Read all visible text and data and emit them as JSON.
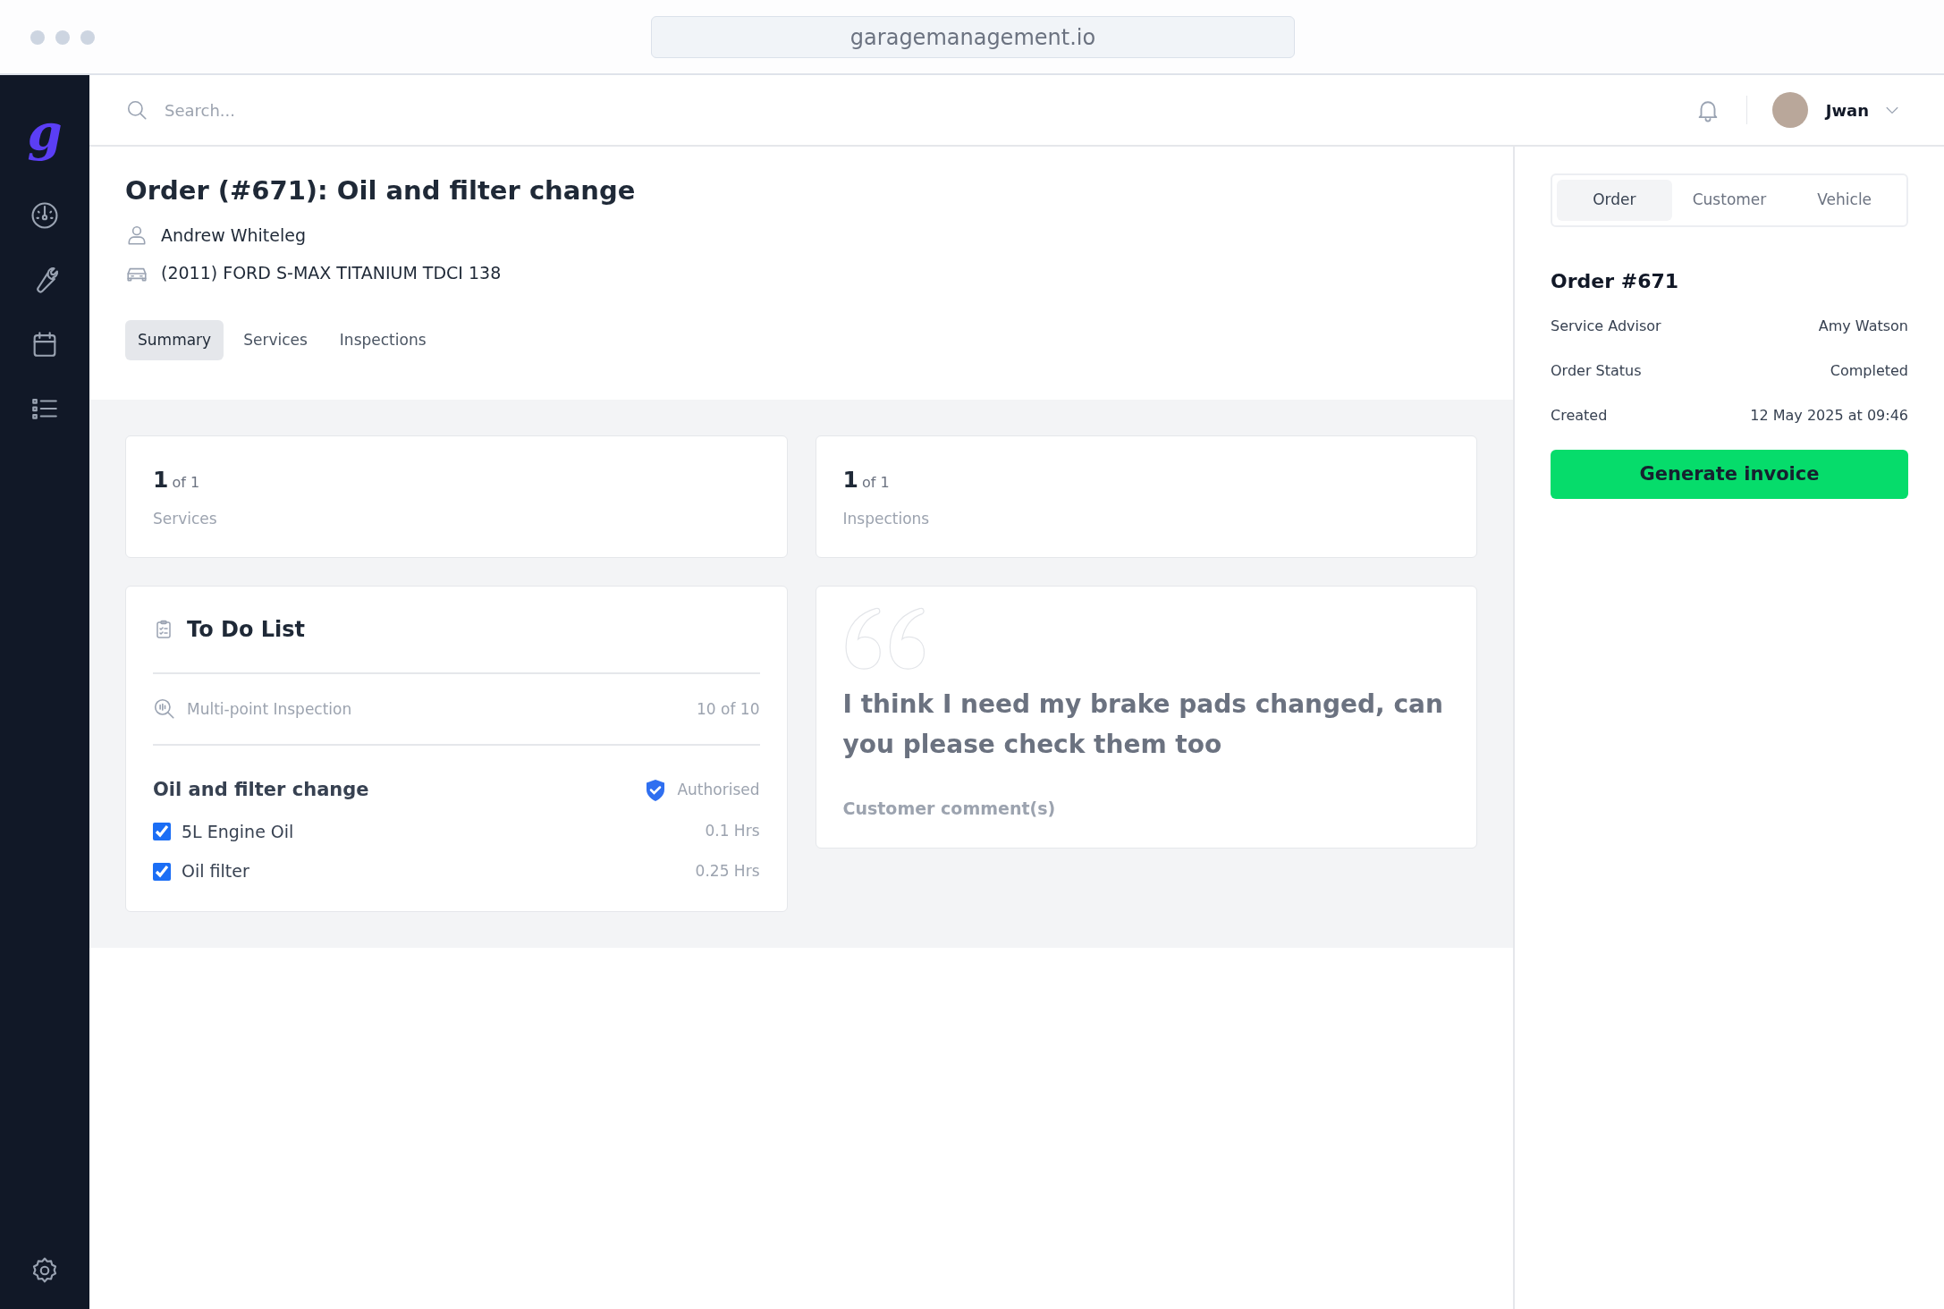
{
  "browser": {
    "url": "garagemanagement.io"
  },
  "sidebar": {
    "logo": "g"
  },
  "header": {
    "search_placeholder": "Search...",
    "user_name": "Jwan"
  },
  "order": {
    "title": "Order (#671): Oil and filter change",
    "customer": "Andrew Whiteleg",
    "vehicle": "(2011) FORD S-MAX TITANIUM TDCI 138",
    "tabs": [
      {
        "label": "Summary",
        "selected": true
      },
      {
        "label": "Services",
        "selected": false
      },
      {
        "label": "Inspections",
        "selected": false
      }
    ]
  },
  "stats": [
    {
      "count": "1",
      "total": "of 1",
      "label": "Services"
    },
    {
      "count": "1",
      "total": "of 1",
      "label": "Inspections"
    }
  ],
  "todo": {
    "title": "To Do List",
    "inspection": {
      "label": "Multi-point Inspection",
      "progress": "10 of 10"
    },
    "service": {
      "title": "Oil and filter change",
      "status": "Authorised"
    },
    "items": [
      {
        "label": "5L Engine Oil",
        "checked": true,
        "hours": "0.1 Hrs"
      },
      {
        "label": "Oil filter",
        "checked": true,
        "hours": "0.25 Hrs"
      }
    ]
  },
  "comment": {
    "text": "I think I need my brake pads changed, can you please check them too",
    "label": "Customer comment(s)"
  },
  "panel": {
    "tabs": [
      {
        "label": "Order",
        "selected": true
      },
      {
        "label": "Customer",
        "selected": false
      },
      {
        "label": "Vehicle",
        "selected": false
      }
    ],
    "heading": "Order #671",
    "fields": [
      {
        "label": "Service Advisor",
        "value": "Amy Watson"
      },
      {
        "label": "Order Status",
        "value": "Completed"
      },
      {
        "label": "Created",
        "value": "12 May 2025 at 09:46"
      }
    ],
    "button": "Generate invoice"
  }
}
